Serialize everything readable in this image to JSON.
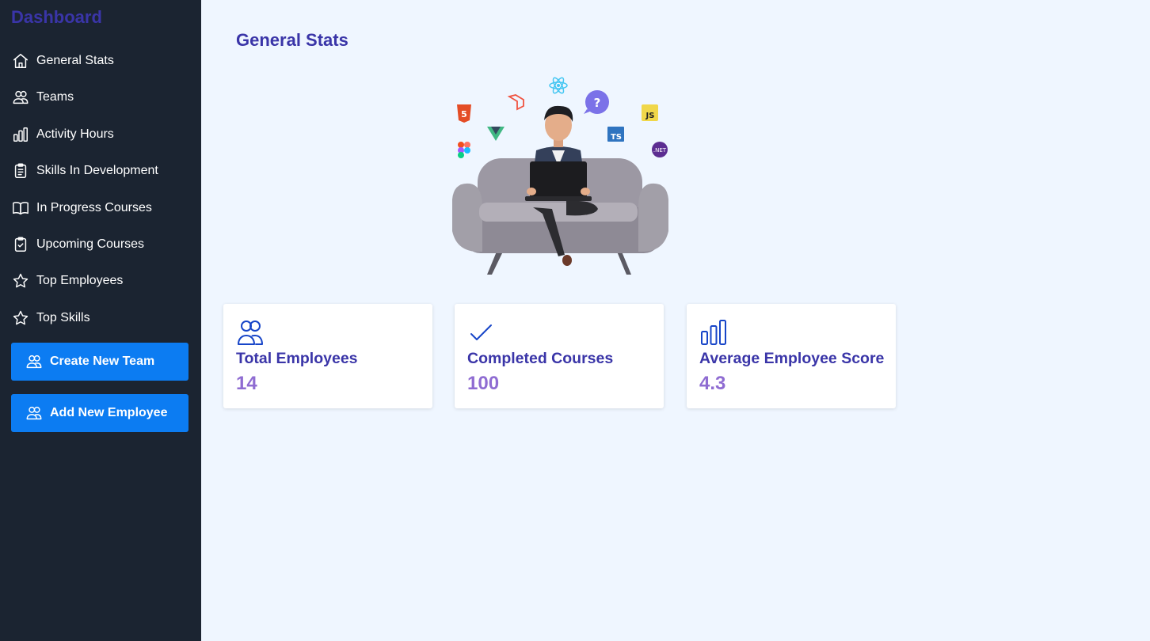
{
  "sidebar": {
    "brand": "Dashboard",
    "items": [
      {
        "label": "General Stats",
        "icon": "home-icon"
      },
      {
        "label": "Teams",
        "icon": "users-icon"
      },
      {
        "label": "Activity Hours",
        "icon": "bar-chart-icon"
      },
      {
        "label": "Skills In Development",
        "icon": "clipboard-list-icon"
      },
      {
        "label": "In Progress Courses",
        "icon": "book-open-icon"
      },
      {
        "label": "Upcoming Courses",
        "icon": "clipboard-check-icon"
      },
      {
        "label": "Top Employees",
        "icon": "star-icon"
      },
      {
        "label": "Top Skills",
        "icon": "star-icon"
      }
    ],
    "buttons": {
      "create_team": "Create New Team",
      "add_employee": "Add New Employee"
    }
  },
  "main": {
    "title": "General Stats",
    "hero_tech_badges": [
      "HTML5",
      "Laravel",
      "React",
      "Help",
      "JS",
      "Vue",
      "TS",
      "Figma",
      ".NET"
    ],
    "badge_text": {
      "help": "?",
      "js": "JS",
      "ts": "TS",
      "dotnet": ".NET",
      "html": "5"
    },
    "cards": [
      {
        "label": "Total Employees",
        "value": "14",
        "icon": "users-icon"
      },
      {
        "label": "Completed Courses",
        "value": "100",
        "icon": "check-icon"
      },
      {
        "label": "Average Employee Score",
        "value": "4.3",
        "icon": "bar-chart-icon"
      }
    ]
  },
  "colors": {
    "sidebar_bg": "#1b2431",
    "accent": "#0c7cf2",
    "title": "#3a35a8",
    "value": "#8f6cd2",
    "page_bg": "#eff6ff"
  }
}
